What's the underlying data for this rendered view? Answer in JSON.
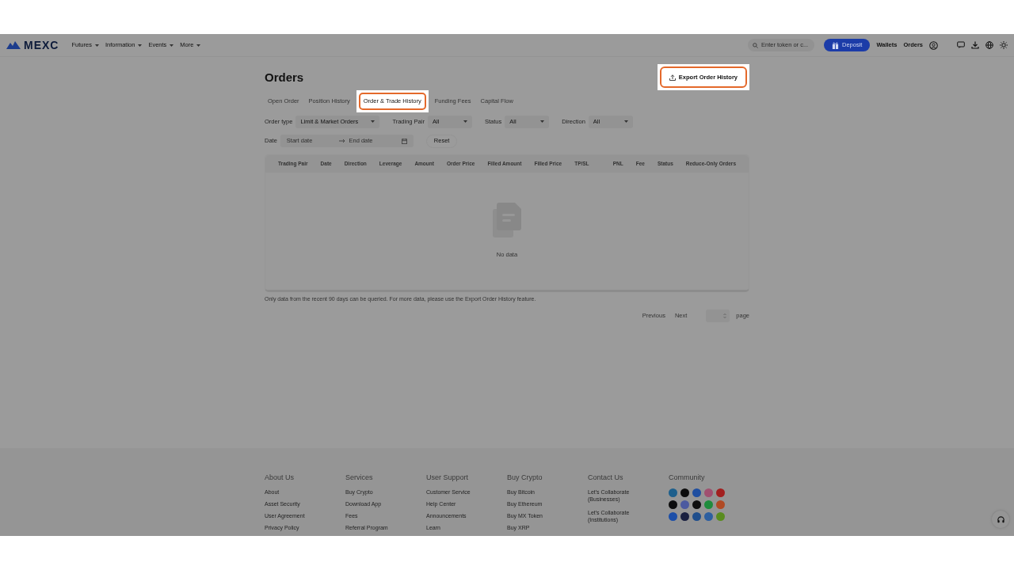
{
  "nav": {
    "logo": "MEXC",
    "menus": [
      {
        "label": "Futures"
      },
      {
        "label": "Information"
      },
      {
        "label": "Events"
      },
      {
        "label": "More"
      }
    ],
    "search": {
      "placeholder": "Enter token or c..."
    },
    "deposit": "Deposit",
    "links": [
      "Wallets",
      "Orders"
    ]
  },
  "page": {
    "title": "Orders",
    "export_button": {
      "label": "Export Order History",
      "highlighted": true
    },
    "tabs": [
      {
        "label": "Open Order",
        "selected": false,
        "highlighted": false
      },
      {
        "label": "Position History",
        "selected": false,
        "highlighted": false
      },
      {
        "label": "Order & Trade History",
        "selected": true,
        "highlighted": true
      },
      {
        "label": "Funding Fees",
        "selected": false,
        "highlighted": false
      },
      {
        "label": "Capital Flow",
        "selected": false,
        "highlighted": false
      }
    ],
    "filters": [
      {
        "label": "Order type",
        "value": "Limit & Market Orders"
      },
      {
        "label": "Trading Pair",
        "value": "All"
      },
      {
        "label": "Status",
        "value": "All"
      },
      {
        "label": "Direction",
        "value": "All"
      }
    ],
    "date": {
      "label": "Date",
      "start_placeholder": "Start date",
      "end_placeholder": "End date"
    },
    "reset": "Reset",
    "table": {
      "columns": [
        "Trading Pair",
        "Date",
        "Direction",
        "Leverage",
        "Amount",
        "Order Price",
        "Filled Amount",
        "Filled Price",
        "TP/SL"
      ],
      "right_columns": [
        "PNL",
        "Fee",
        "Status",
        "Reduce-Only Orders"
      ],
      "empty_text": "No data"
    },
    "note": {
      "text": "Only data from the recent 90 days can be queried. For more data, please use the",
      "link": "Export Order History",
      "suffix": "feature."
    },
    "pagination": {
      "previous": "Previous",
      "next": "Next",
      "suffix": "page"
    }
  },
  "footer": {
    "columns": [
      {
        "title": "About Us",
        "links": [
          "About",
          "Asset Security",
          "User Agreement",
          "Privacy Policy"
        ]
      },
      {
        "title": "Services",
        "links": [
          "Buy Crypto",
          "Download App",
          "Fees",
          "Referral Program"
        ]
      },
      {
        "title": "User Support",
        "links": [
          "Customer Service",
          "Help Center",
          "Announcements",
          "Learn"
        ]
      },
      {
        "title": "Buy Crypto",
        "links": [
          "Buy Bitcoin",
          "Buy Ethereum",
          "Buy MX Token",
          "Buy XRP"
        ]
      },
      {
        "title": "Contact Us",
        "links": [
          "Let's Collaborate (Businesses)",
          "Let's Collaborate (Institutions)"
        ]
      },
      {
        "title": "Community"
      }
    ]
  }
}
